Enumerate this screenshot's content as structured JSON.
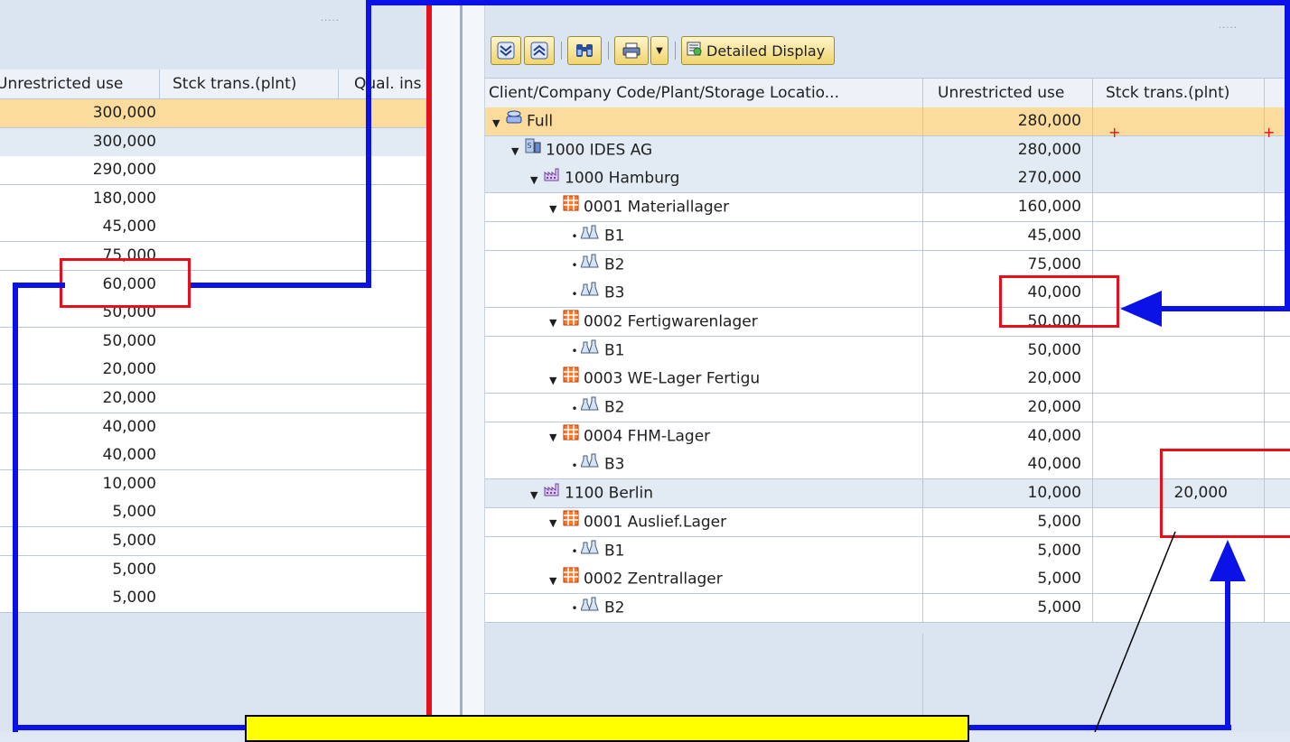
{
  "left_panel": {
    "columns": [
      "Unrestricted use",
      "Stck trans.(plnt)",
      "Qual. ins"
    ],
    "values": [
      "300,000",
      "300,000",
      "290,000",
      "180,000",
      "45,000",
      "75,000",
      "60,000",
      "50,000",
      "50,000",
      "20,000",
      "20,000",
      "40,000",
      "40,000",
      "10,000",
      "5,000",
      "5,000",
      "5,000",
      "5,000"
    ]
  },
  "toolbar": {
    "expand_all_icon": "expand-all-icon",
    "collapse_all_icon": "collapse-all-icon",
    "find_icon": "binoculars-icon",
    "print_icon": "printer-icon",
    "dropdown_icon": "dropdown-arrow-icon",
    "detailed_display_label": "Detailed Display"
  },
  "right_panel": {
    "columns": [
      "Client/Company Code/Plant/Storage Locatio...",
      "Unrestricted use",
      "Stck trans.(plnt)"
    ],
    "rows": [
      {
        "level": 0,
        "node": "expanded",
        "icon": "client-icon",
        "label": "Full",
        "value": "280,000",
        "stock_transfer": ""
      },
      {
        "level": 1,
        "node": "expanded",
        "icon": "company-code-icon",
        "label": "1000 IDES AG",
        "value": "280,000",
        "stock_transfer": ""
      },
      {
        "level": 2,
        "node": "expanded",
        "icon": "plant-icon",
        "label": "1000 Hamburg",
        "value": "270,000",
        "stock_transfer": ""
      },
      {
        "level": 3,
        "node": "expanded",
        "icon": "storage-location-icon",
        "label": "0001 Materiallager",
        "value": "160,000",
        "stock_transfer": ""
      },
      {
        "level": 4,
        "node": "leaf",
        "icon": "batch-icon",
        "label": "B1",
        "value": "45,000",
        "stock_transfer": ""
      },
      {
        "level": 4,
        "node": "leaf",
        "icon": "batch-icon",
        "label": "B2",
        "value": "75,000",
        "stock_transfer": ""
      },
      {
        "level": 4,
        "node": "leaf",
        "icon": "batch-icon",
        "label": "B3",
        "value": "40,000",
        "stock_transfer": ""
      },
      {
        "level": 3,
        "node": "expanded",
        "icon": "storage-location-icon",
        "label": "0002 Fertigwarenlager",
        "value": "50,000",
        "stock_transfer": ""
      },
      {
        "level": 4,
        "node": "leaf",
        "icon": "batch-icon",
        "label": "B1",
        "value": "50,000",
        "stock_transfer": ""
      },
      {
        "level": 3,
        "node": "expanded",
        "icon": "storage-location-icon",
        "label": "0003 WE-Lager Fertigu",
        "value": "20,000",
        "stock_transfer": ""
      },
      {
        "level": 4,
        "node": "leaf",
        "icon": "batch-icon",
        "label": "B2",
        "value": "20,000",
        "stock_transfer": ""
      },
      {
        "level": 3,
        "node": "expanded",
        "icon": "storage-location-icon",
        "label": "0004 FHM-Lager",
        "value": "40,000",
        "stock_transfer": ""
      },
      {
        "level": 4,
        "node": "leaf",
        "icon": "batch-icon",
        "label": "B3",
        "value": "40,000",
        "stock_transfer": ""
      },
      {
        "level": 2,
        "node": "expanded",
        "icon": "plant-icon",
        "label": "1100 Berlin",
        "value": "10,000",
        "stock_transfer": "20,000"
      },
      {
        "level": 3,
        "node": "expanded",
        "icon": "storage-location-icon",
        "label": "0001 Auslief.Lager",
        "value": "5,000",
        "stock_transfer": ""
      },
      {
        "level": 4,
        "node": "leaf",
        "icon": "batch-icon",
        "label": "B1",
        "value": "5,000",
        "stock_transfer": ""
      },
      {
        "level": 3,
        "node": "expanded",
        "icon": "storage-location-icon",
        "label": "0002 Zentrallager",
        "value": "5,000",
        "stock_transfer": ""
      },
      {
        "level": 4,
        "node": "leaf",
        "icon": "batch-icon",
        "label": "B2",
        "value": "5,000",
        "stock_transfer": ""
      }
    ]
  },
  "annotations": {
    "highlight_color": "#e5101a",
    "connector_color": "#0a12e8",
    "callout_fill": "#ffff00"
  }
}
